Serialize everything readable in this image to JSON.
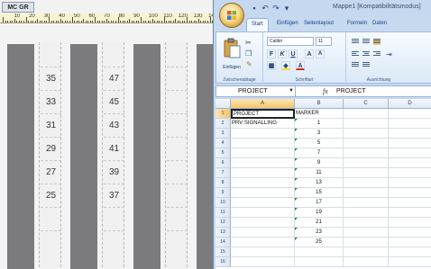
{
  "left_app": {
    "tab_label": "MC GR",
    "ruler_numbers": [
      "10",
      "20",
      "30",
      "40",
      "50",
      "60",
      "70",
      "80",
      "90",
      "100",
      "110",
      "120",
      "130",
      "140"
    ],
    "strips": [
      {
        "cells": [
          "",
          "35",
          "33",
          "31",
          "29",
          "27",
          "25",
          ""
        ]
      },
      {
        "cells": [
          "",
          "47",
          "45",
          "43",
          "41",
          "39",
          "37",
          ""
        ]
      },
      {
        "cells": [
          "",
          "",
          "",
          "",
          "",
          "",
          "",
          ""
        ]
      }
    ]
  },
  "excel": {
    "title": "Mappe1  [Kompatibilitätsmodus]",
    "ribbon_tabs": [
      "Start",
      "Einfügen",
      "Seitenlayout",
      "Formeln",
      "Daten"
    ],
    "active_tab": "Start",
    "groups": {
      "clipboard": {
        "paste_label": "Einfügen",
        "group_label": "Zwischenablage"
      },
      "font": {
        "font_name": "Calibri",
        "font_size": "11",
        "group_label": "Schriftart"
      },
      "alignment": {
        "group_label": "Ausrichtung"
      }
    },
    "name_box": "PROJECT",
    "fx_label": "fx",
    "formula_value": "PROJECT",
    "columns": [
      "A",
      "B",
      "C",
      "D"
    ],
    "rows": [
      {
        "n": "1",
        "a": "PROJECT",
        "b": "MARKER"
      },
      {
        "n": "2",
        "a": "PRV SIGNALLING",
        "b": "1"
      },
      {
        "n": "3",
        "a": "",
        "b": "3"
      },
      {
        "n": "4",
        "a": "",
        "b": "5"
      },
      {
        "n": "5",
        "a": "",
        "b": "7"
      },
      {
        "n": "6",
        "a": "",
        "b": "9"
      },
      {
        "n": "7",
        "a": "",
        "b": "11"
      },
      {
        "n": "8",
        "a": "",
        "b": "13"
      },
      {
        "n": "9",
        "a": "",
        "b": "15"
      },
      {
        "n": "10",
        "a": "",
        "b": "17"
      },
      {
        "n": "11",
        "a": "",
        "b": "19"
      },
      {
        "n": "12",
        "a": "",
        "b": "21"
      },
      {
        "n": "13",
        "a": "",
        "b": "23"
      },
      {
        "n": "14",
        "a": "",
        "b": "25"
      },
      {
        "n": "15",
        "a": "",
        "b": ""
      },
      {
        "n": "16",
        "a": "",
        "b": ""
      }
    ],
    "colors": {
      "accent": "#15428b",
      "selection": "#f5c56d",
      "error_marker": "#1e8b35"
    }
  }
}
